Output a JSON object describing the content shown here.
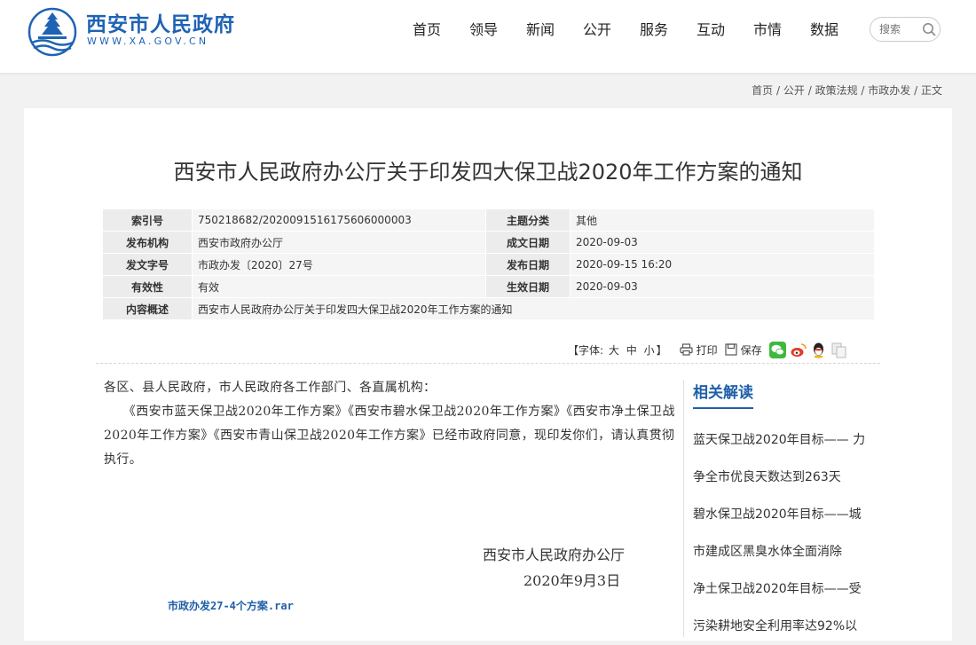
{
  "header": {
    "site_name": "西安市人民政府",
    "site_url": "WWW.XA.GOV.CN",
    "nav": [
      "首页",
      "领导",
      "新闻",
      "公开",
      "服务",
      "互动",
      "市情",
      "数据"
    ],
    "search_placeholder": "搜索"
  },
  "breadcrumb": [
    "首页",
    "公开",
    "政策法规",
    "市政办发",
    "正文"
  ],
  "article": {
    "title": "西安市人民政府办公厅关于印发四大保卫战2020年工作方案的通知",
    "meta": {
      "index_no_label": "索引号",
      "index_no": "750218682/202009151617560600000 3",
      "topic_label": "主题分类",
      "topic": "其他",
      "publisher_label": "发布机构",
      "publisher": "西安市政府办公厅",
      "written_date_label": "成文日期",
      "written_date": "2020-09-03",
      "doc_no_label": "发文字号",
      "doc_no": "市政办发〔2020〕27号",
      "publish_date_label": "发布日期",
      "publish_date": "2020-09-15 16:20",
      "validity_label": "有效性",
      "validity": "有效",
      "effective_date_label": "生效日期",
      "effective_date": "2020-09-03",
      "summary_label": "内容概述",
      "summary": "西安市人民政府办公厅关于印发四大保卫战2020年工作方案的通知"
    },
    "tools": {
      "font_size_prefix": "【字体:",
      "font_large": "大",
      "font_medium": "中",
      "font_small": "小",
      "font_size_suffix": "】",
      "print": "打印",
      "save": "保存"
    },
    "body": {
      "line1": "各区、县人民政府，市人民政府各工作部门、各直属机构：",
      "paragraph": "　　《西安市蓝天保卫战2020年工作方案》《西安市碧水保卫战2020年工作方案》《西安市净土保卫战2020年工作方案》《西安市青山保卫战2020年工作方案》已经市政府同意，现印发你们，请认真贯彻执行。"
    },
    "signature": "西安市人民政府办公厅",
    "sign_date": "2020年9月3日",
    "attachment": "市政办发27-4个方案.rar"
  },
  "related": {
    "title": "相关解读",
    "items": [
      "蓝天保卫战2020年目标—— 力",
      "争全市优良天数达到263天",
      "碧水保卫战2020年目标——城",
      "市建成区黑臭水体全面消除",
      "净土保卫战2020年目标——受",
      "污染耕地安全利用率达92%以"
    ]
  },
  "colors": {
    "brand_blue": "#1f63b5",
    "link_blue": "#1f5fa8",
    "wechat": "#3dba3d",
    "weibo": "#e33a2b",
    "qq": "#2a8ae0"
  }
}
